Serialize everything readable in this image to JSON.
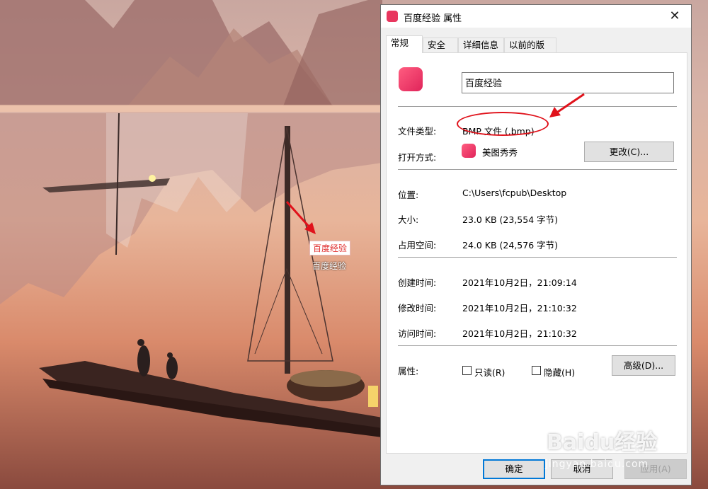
{
  "colors": {
    "accent": "#0078d7",
    "annotation_red": "#e0121b",
    "app_icon": "#e8365e"
  },
  "desktop": {
    "icon_label_selected": "百度经验",
    "icon_label": "百度经验"
  },
  "dialog": {
    "title": "百度经验 属性",
    "close_glyph": "✕",
    "tabs": [
      {
        "label": "常规",
        "active": true
      },
      {
        "label": "安全",
        "active": false
      },
      {
        "label": "详细信息",
        "active": false
      },
      {
        "label": "以前的版本",
        "active": false
      }
    ],
    "general": {
      "file_name": "百度经验",
      "file_type_label": "文件类型:",
      "file_type_value": "BMP 文件 (.bmp)",
      "opens_with_label": "打开方式:",
      "opens_with_value": "美图秀秀",
      "change_button": "更改(C)...",
      "location_label": "位置:",
      "location_value": "C:\\Users\\fcpub\\Desktop",
      "size_label": "大小:",
      "size_value": "23.0 KB (23,554 字节)",
      "size_on_disk_label": "占用空间:",
      "size_on_disk_value": "24.0 KB (24,576 字节)",
      "created_label": "创建时间:",
      "created_value": "2021年10月2日，21:09:14",
      "modified_label": "修改时间:",
      "modified_value": "2021年10月2日，21:10:32",
      "accessed_label": "访问时间:",
      "accessed_value": "2021年10月2日，21:10:32",
      "attributes_label": "属性:",
      "readonly_label": "只读(R)",
      "hidden_label": "隐藏(H)",
      "advanced_button": "高级(D)..."
    },
    "footer": {
      "ok": "确定",
      "cancel": "取消",
      "apply": "应用(A)"
    }
  },
  "watermark": {
    "brand": "Baidu经验",
    "url": "jingyan.baidu.com"
  }
}
